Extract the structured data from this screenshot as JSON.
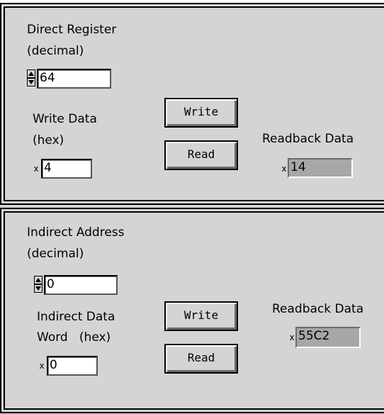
{
  "direct": {
    "register_label_1": "Direct Register",
    "register_label_2": "(decimal)",
    "register_value": "64",
    "write_label_1": "Write Data",
    "write_label_2": "(hex)",
    "write_radix": "x",
    "write_value": "4",
    "write_button": "Write",
    "read_button": "Read",
    "readback_label": "Readback Data",
    "readback_radix": "x",
    "readback_value": "14"
  },
  "indirect": {
    "address_label_1": "Indirect Address",
    "address_label_2": "(decimal)",
    "address_value": "0",
    "data_label_1": "Indirect Data",
    "data_label_2": "Word   (hex)",
    "data_radix": "x",
    "data_value": "0",
    "write_button": "Write",
    "read_button": "Read",
    "readback_label": "Readback Data",
    "readback_radix": "x",
    "readback_value": "55C2"
  },
  "colors": {
    "panel_bg": "#d4d4d4",
    "indicator_bg": "#a7a7a7",
    "input_bg": "#ffffff"
  }
}
